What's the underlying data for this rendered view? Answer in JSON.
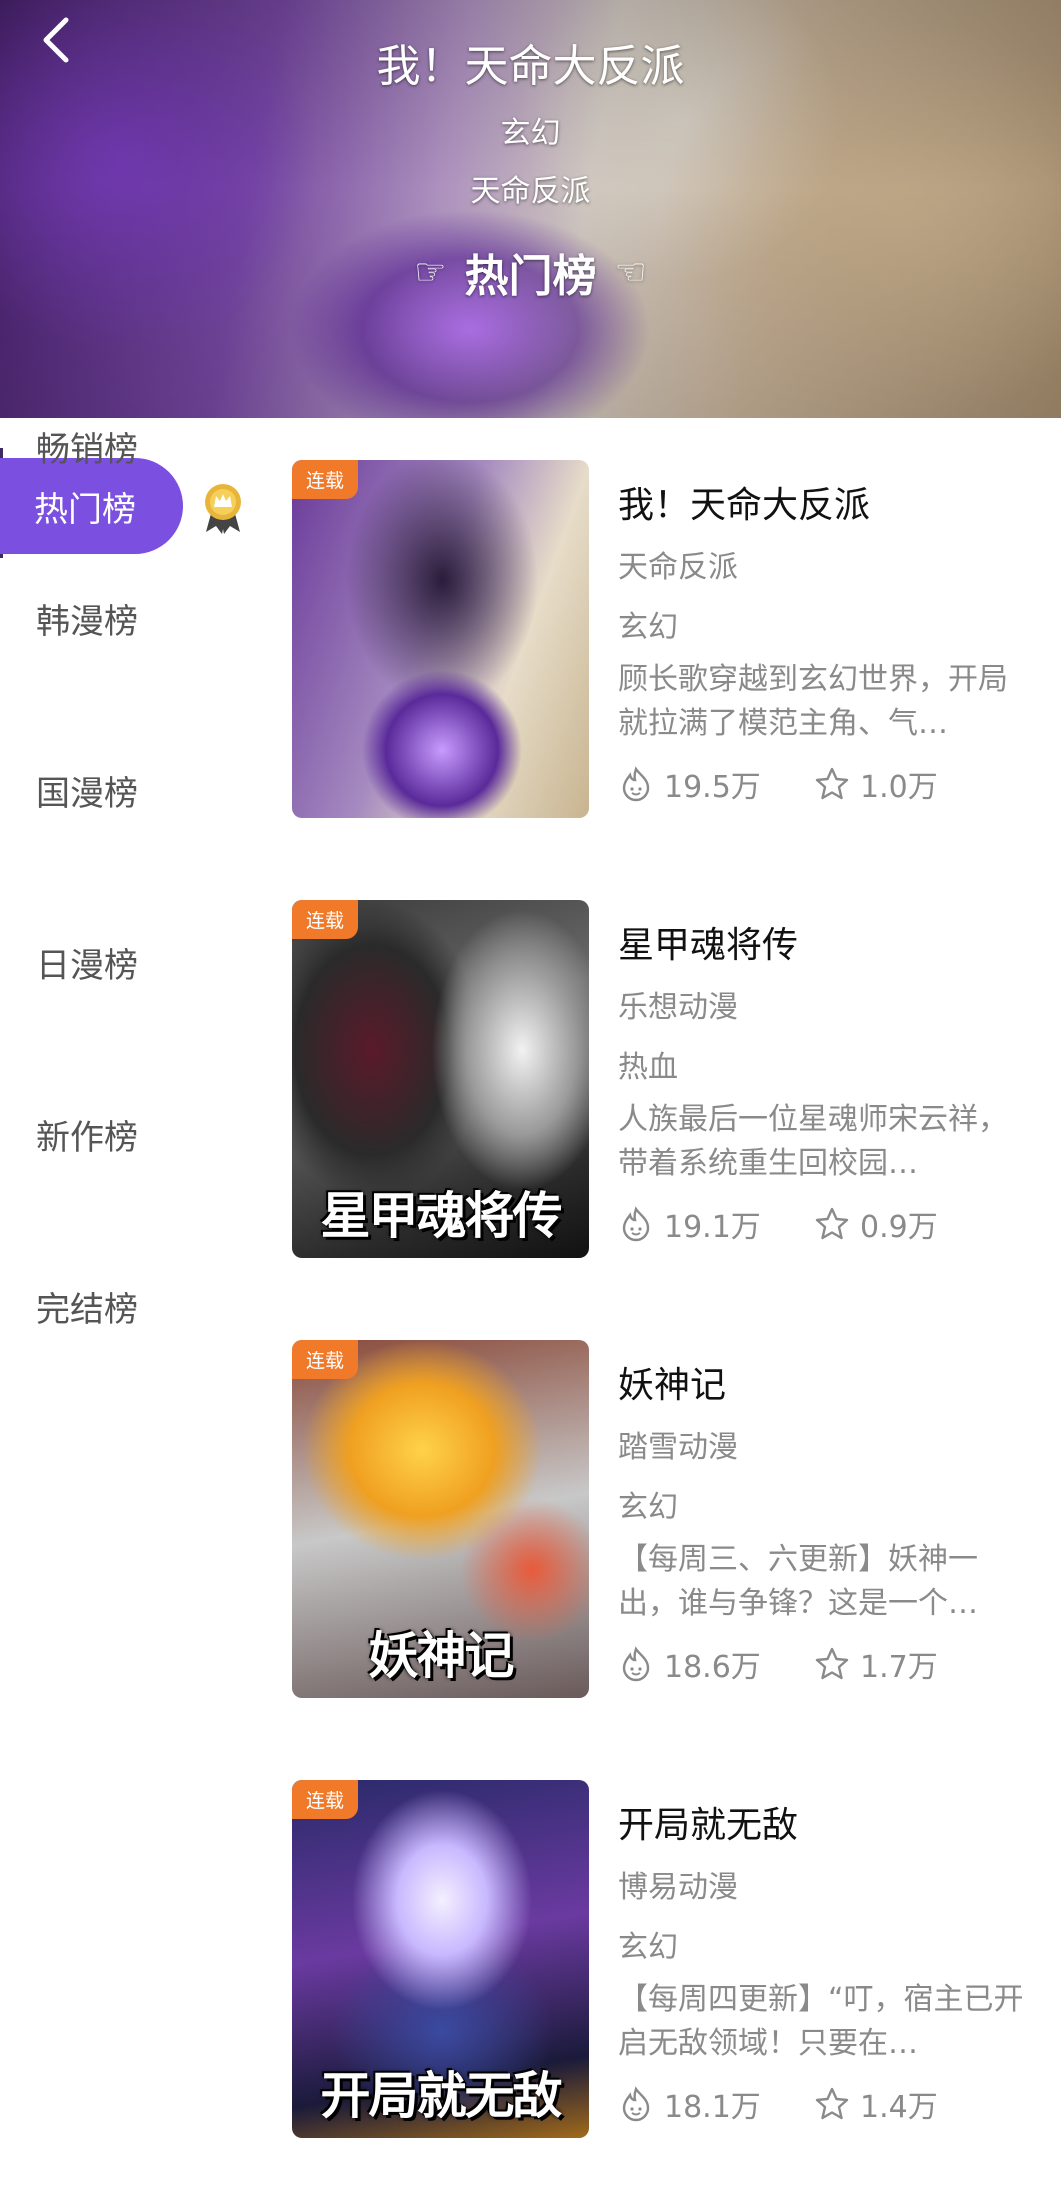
{
  "hero": {
    "title": "我！天命大反派",
    "genre": "玄幻",
    "author": "天命反派",
    "rank_label": "热门榜",
    "hand_left": "☜",
    "hand_right": "☞",
    "back_icon": "chevron-left-icon"
  },
  "sidebar": {
    "active": "热门榜",
    "items": [
      "畅销榜",
      "韩漫榜",
      "国漫榜",
      "日漫榜",
      "新作榜",
      "完结榜"
    ],
    "accent": "#7b4fe0"
  },
  "list": [
    {
      "tag": "连载",
      "cover_title": "",
      "title": "我！天命大反派",
      "author": "天命反派",
      "genre": "玄幻",
      "desc": "顾长歌穿越到玄幻世界，开局就拉满了模范主角、气…",
      "views": "19.5万",
      "favs": "1.0万"
    },
    {
      "tag": "连载",
      "cover_title": "星甲魂将传",
      "title": "星甲魂将传",
      "author": "乐想动漫",
      "genre": "热血",
      "desc": "人族最后一位星魂师宋云祥，带着系统重生回校园…",
      "views": "19.1万",
      "favs": "0.9万"
    },
    {
      "tag": "连载",
      "cover_title": "妖神记",
      "title": "妖神记",
      "author": "踏雪动漫",
      "genre": "玄幻",
      "desc": "【每周三、六更新】妖神一出，谁与争锋？这是一个…",
      "views": "18.6万",
      "favs": "1.7万"
    },
    {
      "tag": "连载",
      "cover_title": "开局就无敌",
      "title": "开局就无敌",
      "author": "博易动漫",
      "genre": "玄幻",
      "desc": "【每周四更新】“叮，宿主已开启无敌领域！只要在…",
      "views": "18.1万",
      "favs": "1.4万"
    }
  ],
  "colors": {
    "tag_bg": "#f07a2a",
    "muted_text": "#8a8a8a"
  }
}
